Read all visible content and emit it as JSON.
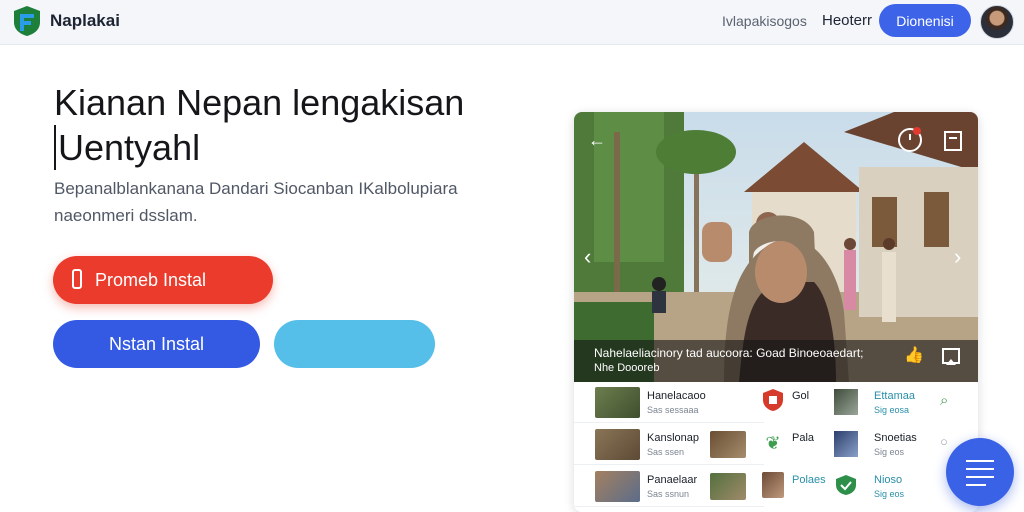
{
  "header": {
    "brand": "Naplakai",
    "nav": [
      "Ivlapakisogos",
      "Heoterr"
    ],
    "cta": "Dionenisi"
  },
  "hero": {
    "title_line1": "Kianan Nepan lengakisan",
    "title_line2": "Uentyahl",
    "subtitle_line1": "Bepanalblankanana Dandari Siocanban IKalbolupiara",
    "subtitle_line2": "naeonmeri dsslam.",
    "primary_button": "Promeb Instal",
    "secondary_button": "Nstan Instal",
    "tertiary_button": ""
  },
  "video": {
    "caption_line1": "Nahelaeliacinory tad aucoora: Goad Binoeoaedart;",
    "caption_line2": "Nhe Doooreb"
  },
  "list": {
    "left": [
      {
        "title": "Hanelacaoo",
        "sub": "Sas sessaaa"
      },
      {
        "title": "Kanslonap",
        "sub": "Sas ssen"
      },
      {
        "title": "Panaelaar",
        "sub": "Sas ssnun"
      }
    ],
    "right": [
      {
        "label": "Gol",
        "title": "Ettamaa",
        "sub": "Sig eosa"
      },
      {
        "label": "Pala",
        "title": "Snoetias",
        "sub": "Sig eos"
      },
      {
        "label": "Polaes",
        "title": "Nioso",
        "sub": "Sig eos"
      }
    ]
  },
  "colors": {
    "primary": "#3d63e8",
    "danger": "#ea3b2c",
    "light_blue": "#55bfe9",
    "accent_teal": "#2a8fa8"
  },
  "icons": {
    "logo": "shield-f-logo",
    "back": "back-arrow-icon",
    "timer": "timer-icon",
    "bookmark": "bookmark-icon",
    "like": "thumbs-up-icon",
    "cast": "cast-icon",
    "menu": "list-icon"
  }
}
